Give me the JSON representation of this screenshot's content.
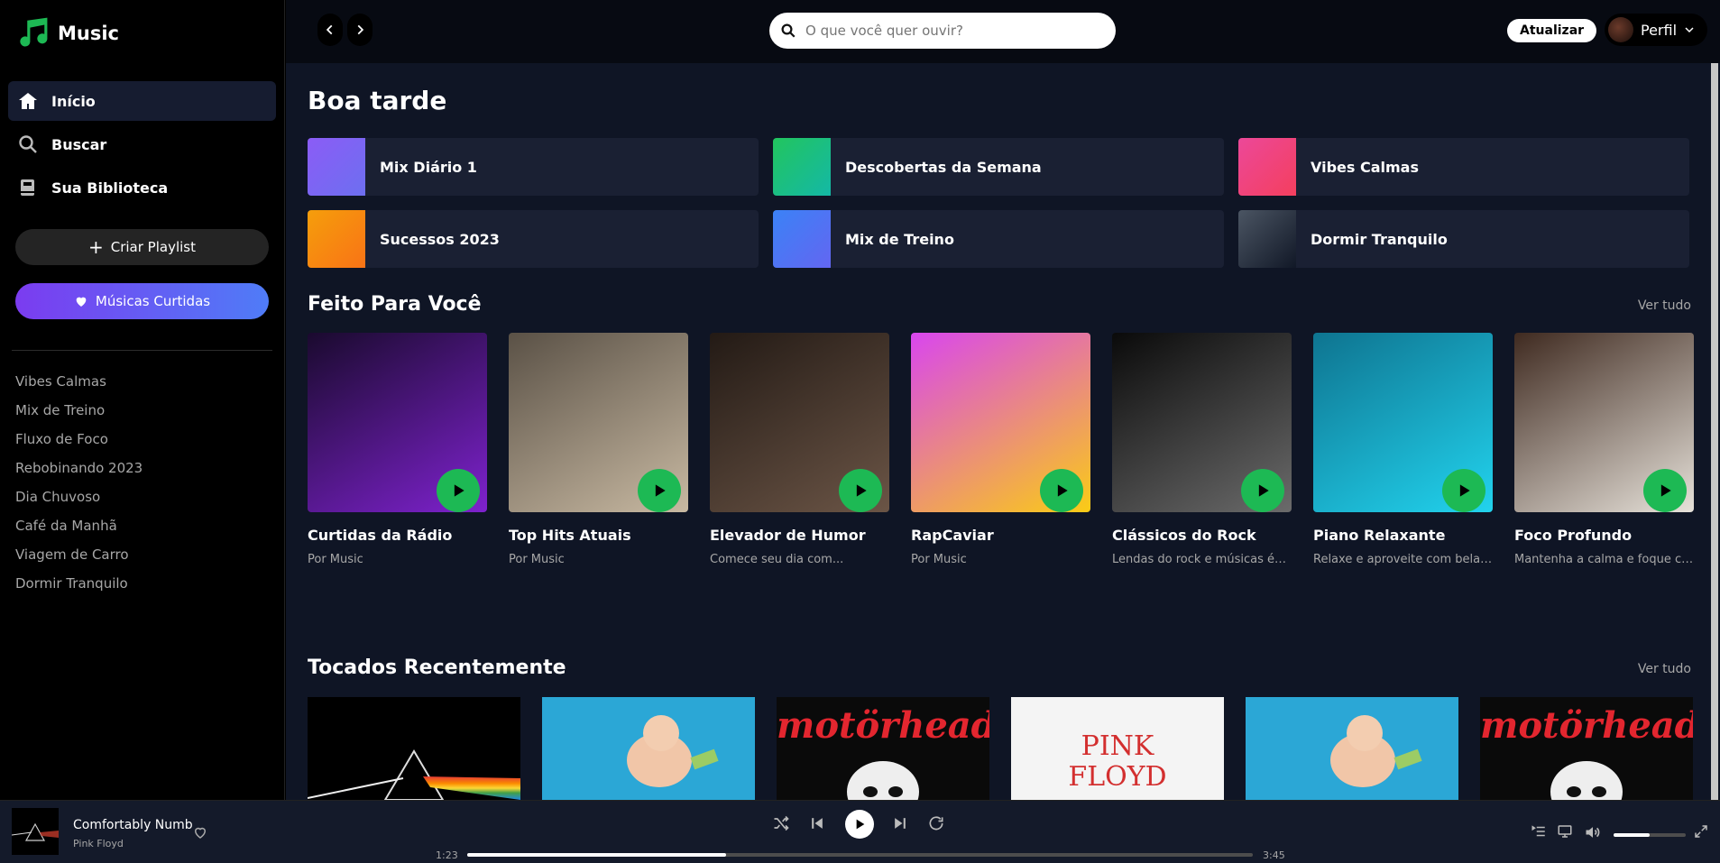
{
  "app": {
    "name": "Music"
  },
  "sidebar": {
    "nav": [
      {
        "label": "Início",
        "icon": "home-icon",
        "active": true
      },
      {
        "label": "Buscar",
        "icon": "search-icon",
        "active": false
      },
      {
        "label": "Sua Biblioteca",
        "icon": "library-icon",
        "active": false
      }
    ],
    "create_playlist": "Criar Playlist",
    "liked_songs": "Músicas Curtidas",
    "playlists": [
      "Vibes Calmas",
      "Mix de Treino",
      "Fluxo de Foco",
      "Rebobinando 2023",
      "Dia Chuvoso",
      "Café da Manhã",
      "Viagem de Carro",
      "Dormir Tranquilo"
    ]
  },
  "topbar": {
    "search_placeholder": "O que você quer ouvir?",
    "update_label": "Atualizar",
    "profile_label": "Perfil"
  },
  "main": {
    "greeting": "Boa tarde",
    "quick_picks": [
      {
        "label": "Mix Diário 1",
        "color_a": "#8b5cf6",
        "color_b": "#6d6ff0"
      },
      {
        "label": "Descobertas da Semana",
        "color_a": "#22c55e",
        "color_b": "#14b8a6"
      },
      {
        "label": "Vibes Calmas",
        "color_a": "#ec4899",
        "color_b": "#f43f5e"
      },
      {
        "label": "Sucessos 2023",
        "color_a": "#f59e0b",
        "color_b": "#f97316"
      },
      {
        "label": "Mix de Treino",
        "color_a": "#3b82f6",
        "color_b": "#6366f1"
      },
      {
        "label": "Dormir Tranquilo",
        "color_a": "#4b5563",
        "color_b": "#111827"
      }
    ],
    "made_for_you": {
      "title": "Feito Para Você",
      "see_all": "Ver tudo",
      "cards": [
        {
          "title": "Curtidas da Rádio",
          "subtitle": "Por Music",
          "bg_a": "#1a0a2e",
          "bg_b": "#7e22ce"
        },
        {
          "title": "Top Hits Atuais",
          "subtitle": "Por Music",
          "bg_a": "#5a5146",
          "bg_b": "#c8b9a2"
        },
        {
          "title": "Elevador de Humor",
          "subtitle": "Comece seu dia com...",
          "bg_a": "#231a15",
          "bg_b": "#6b5546"
        },
        {
          "title": "RapCaviar",
          "subtitle": "Por Music",
          "bg_a": "#d946ef",
          "bg_b": "#facc15"
        },
        {
          "title": "Clássicos do Rock",
          "subtitle": "Lendas do rock e músicas épi...",
          "bg_a": "#0a0a0a",
          "bg_b": "#6b6b6b"
        },
        {
          "title": "Piano Relaxante",
          "subtitle": "Relaxe e aproveite com belas...",
          "bg_a": "#0e7490",
          "bg_b": "#22d3ee"
        },
        {
          "title": "Foco Profundo",
          "subtitle": "Mantenha a calma e foque co...",
          "bg_a": "#3f2a20",
          "bg_b": "#e7e2da"
        }
      ]
    },
    "recently_played": {
      "title": "Tocados Recentemente",
      "see_all": "Ver tudo",
      "items": [
        {
          "name": "pink-floyd-prism",
          "bg": "#000000"
        },
        {
          "name": "nevermind-baby",
          "bg": "#2ba7d6"
        },
        {
          "name": "motorhead",
          "bg": "#0a0a0a",
          "text": "motörhead"
        },
        {
          "name": "pink-floyd-wall",
          "bg": "#f4f4f4",
          "text": "PINK FLOYD"
        },
        {
          "name": "nevermind-baby",
          "bg": "#2ba7d6"
        },
        {
          "name": "motorhead",
          "bg": "#0a0a0a",
          "text": "motörhead"
        }
      ]
    }
  },
  "player": {
    "track": "Comfortably Numb",
    "artist": "Pink Floyd",
    "elapsed": "1:23",
    "duration": "3:45",
    "progress": 0.33,
    "volume": 0.5
  }
}
